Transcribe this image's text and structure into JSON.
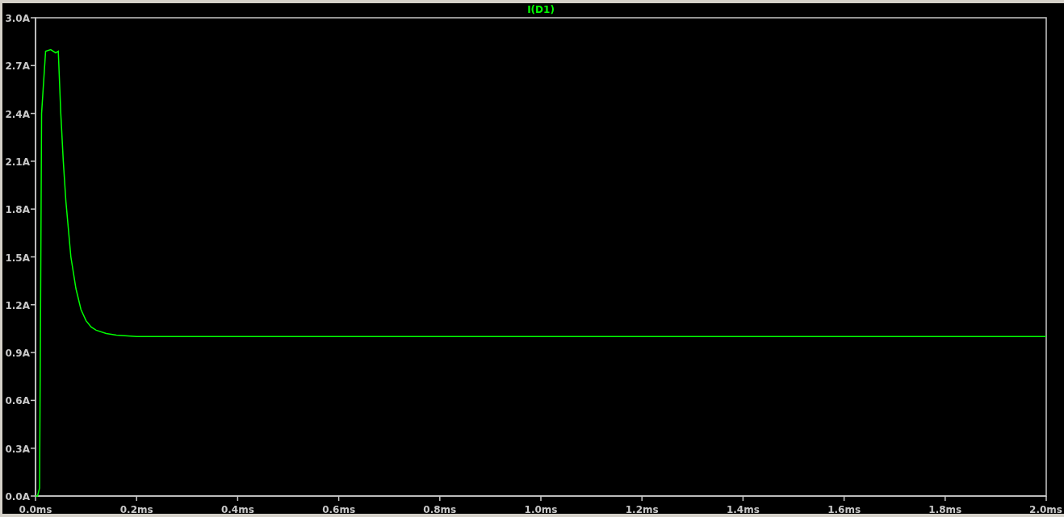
{
  "plot": {
    "chart_data": {
      "type": "line",
      "x": [
        0,
        0.004,
        0.008,
        0.01,
        0.012,
        0.02,
        0.03,
        0.04,
        0.045,
        0.05,
        0.055,
        0.06,
        0.07,
        0.08,
        0.09,
        0.1,
        0.11,
        0.12,
        0.14,
        0.16,
        0.2,
        0.4,
        0.6,
        0.8,
        1.0,
        1.2,
        1.4,
        1.6,
        1.8,
        2.0
      ],
      "series": [
        {
          "name": "I(D1)",
          "color": "#00ff00",
          "values": [
            0,
            0,
            0.05,
            1.2,
            2.4,
            2.79,
            2.8,
            2.78,
            2.79,
            2.4,
            2.1,
            1.85,
            1.5,
            1.3,
            1.17,
            1.1,
            1.06,
            1.04,
            1.02,
            1.01,
            1.0,
            1.0,
            1.0,
            1.0,
            1.0,
            1.0,
            1.0,
            1.0,
            1.0,
            1.0
          ]
        }
      ],
      "xlim": [
        0,
        2
      ],
      "ylim": [
        0,
        3
      ],
      "xticks": [
        {
          "value": 0,
          "label": "0.0ms"
        },
        {
          "value": 0.2,
          "label": "0.2ms"
        },
        {
          "value": 0.4,
          "label": "0.4ms"
        },
        {
          "value": 0.6,
          "label": "0.6ms"
        },
        {
          "value": 0.8,
          "label": "0.8ms"
        },
        {
          "value": 1.0,
          "label": "1.0ms"
        },
        {
          "value": 1.2,
          "label": "1.2ms"
        },
        {
          "value": 1.4,
          "label": "1.4ms"
        },
        {
          "value": 1.6,
          "label": "1.6ms"
        },
        {
          "value": 1.8,
          "label": "1.8ms"
        },
        {
          "value": 2.0,
          "label": "2.0ms"
        }
      ],
      "yticks": [
        {
          "value": 0,
          "label": "0.0A"
        },
        {
          "value": 0.3,
          "label": "0.3A"
        },
        {
          "value": 0.6,
          "label": "0.6A"
        },
        {
          "value": 0.9,
          "label": "0.9A"
        },
        {
          "value": 1.2,
          "label": "1.2A"
        },
        {
          "value": 1.5,
          "label": "1.5A"
        },
        {
          "value": 1.8,
          "label": "1.8A"
        },
        {
          "value": 2.1,
          "label": "2.1A"
        },
        {
          "value": 2.4,
          "label": "2.4A"
        },
        {
          "value": 2.7,
          "label": "2.7A"
        },
        {
          "value": 3.0,
          "label": "3.0A"
        }
      ]
    }
  }
}
